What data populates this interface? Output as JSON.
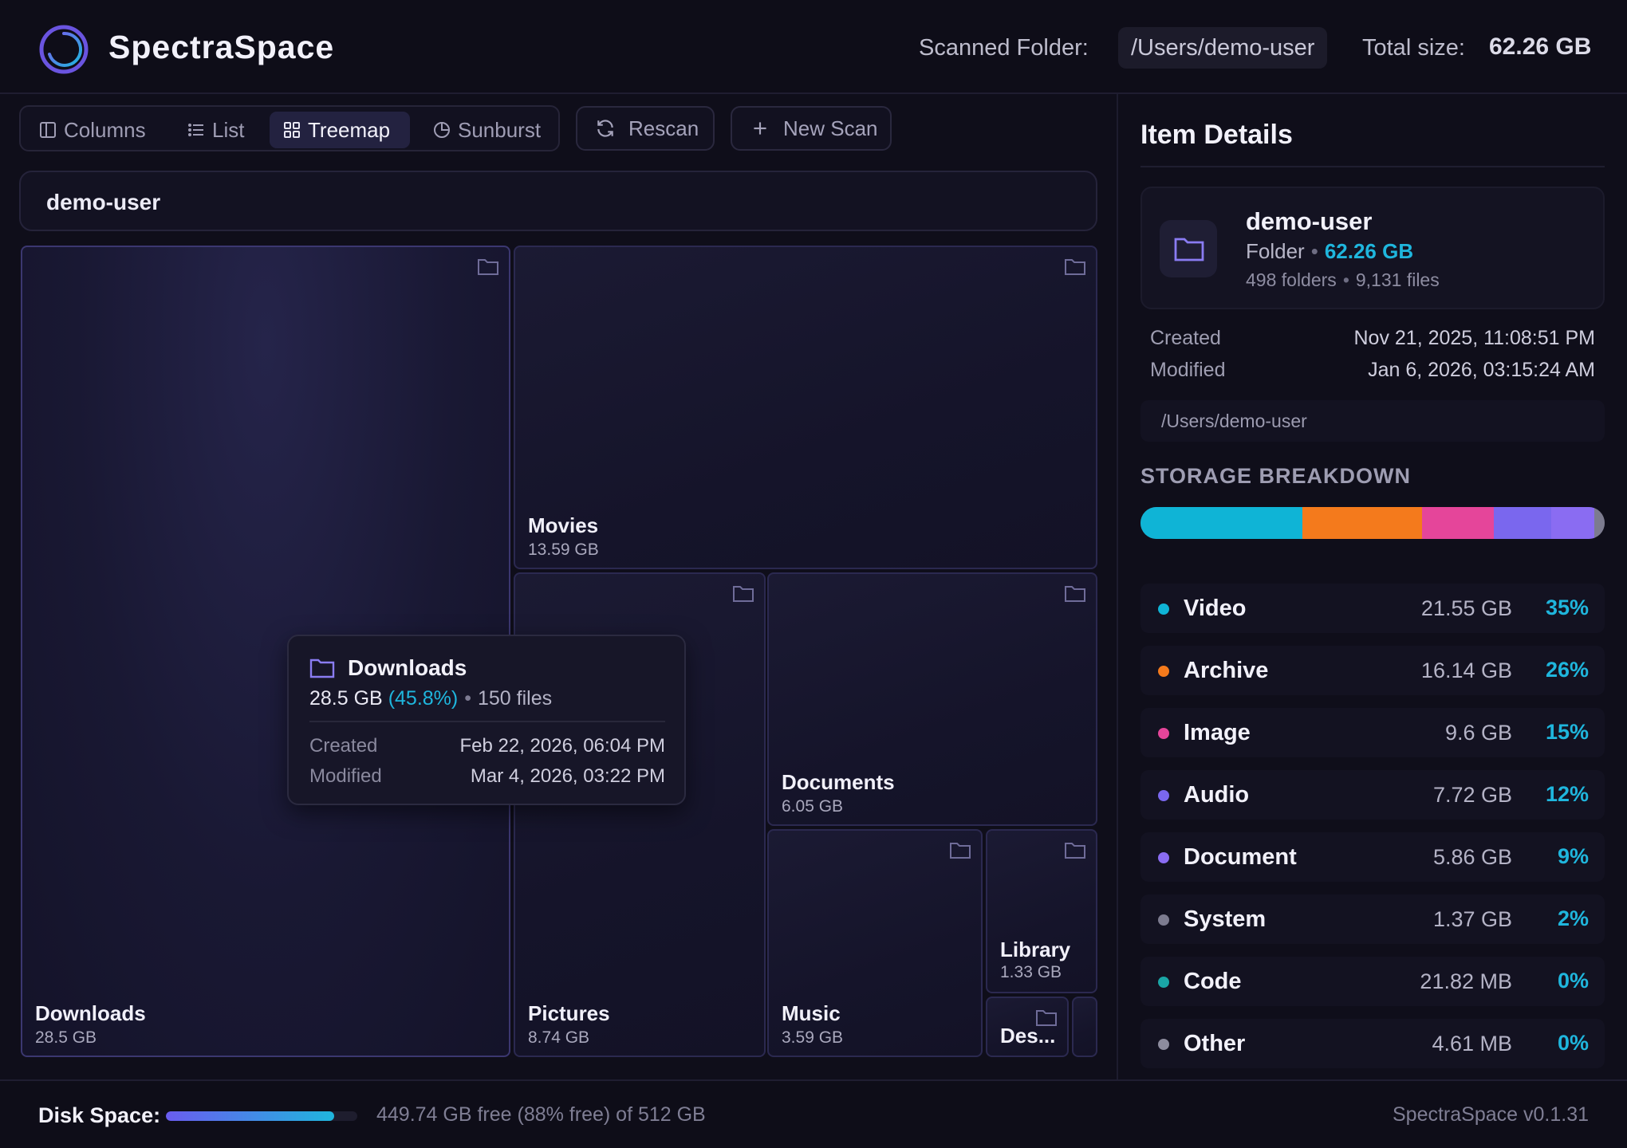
{
  "app": {
    "title": "SpectraSpace",
    "version": "SpectraSpace v0.1.31"
  },
  "header": {
    "scanned_label": "Scanned Folder:",
    "scanned_path": "/Users/demo-user",
    "total_label": "Total size:",
    "total_value": "62.26 GB"
  },
  "toolbar": {
    "views": [
      {
        "label": "Columns",
        "icon": "columns-icon"
      },
      {
        "label": "List",
        "icon": "list-icon"
      },
      {
        "label": "Treemap",
        "icon": "treemap-icon",
        "active": true
      },
      {
        "label": "Sunburst",
        "icon": "sunburst-icon"
      }
    ],
    "rescan_label": "Rescan",
    "new_scan_label": "New Scan"
  },
  "breadcrumb": "demo-user",
  "treemap": {
    "tiles": [
      {
        "name": "Downloads",
        "size": "28.5 GB"
      },
      {
        "name": "Movies",
        "size": "13.59 GB"
      },
      {
        "name": "Pictures",
        "size": "8.74 GB"
      },
      {
        "name": "Documents",
        "size": "6.05 GB"
      },
      {
        "name": "Music",
        "size": "3.59 GB"
      },
      {
        "name": "Library",
        "size": "1.33 GB"
      },
      {
        "name": "Des..."
      }
    ]
  },
  "tooltip": {
    "title": "Downloads",
    "size": "28.5 GB",
    "percent": "(45.8%)",
    "separator": "•",
    "files": "150 files",
    "created_label": "Created",
    "created_value": "Feb 22, 2026, 06:04 PM",
    "modified_label": "Modified",
    "modified_value": "Mar 4, 2026, 03:22 PM"
  },
  "details": {
    "title": "Item Details",
    "name": "demo-user",
    "type": "Folder",
    "separator": "•",
    "size": "62.26 GB",
    "folders": "498 folders",
    "files": "9,131 files",
    "created_label": "Created",
    "created_value": "Nov 21, 2025, 11:08:51 PM",
    "modified_label": "Modified",
    "modified_value": "Jan 6, 2026, 03:15:24 AM",
    "path": "/Users/demo-user"
  },
  "storage": {
    "title": "STORAGE BREAKDOWN",
    "categories": [
      {
        "name": "Video",
        "size": "21.55 GB",
        "pct": "35%",
        "fraction": 0.35,
        "color": "#0fb4d6"
      },
      {
        "name": "Archive",
        "size": "16.14 GB",
        "pct": "26%",
        "fraction": 0.26,
        "color": "#f47a1c"
      },
      {
        "name": "Image",
        "size": "9.6 GB",
        "pct": "15%",
        "fraction": 0.155,
        "color": "#e5459a"
      },
      {
        "name": "Audio",
        "size": "7.72 GB",
        "pct": "12%",
        "fraction": 0.124,
        "color": "#7a67ee"
      },
      {
        "name": "Document",
        "size": "5.86 GB",
        "pct": "9%",
        "fraction": 0.094,
        "color": "#8a6cf2"
      },
      {
        "name": "System",
        "size": "1.37 GB",
        "pct": "2%",
        "fraction": 0.022,
        "color": "#7c7b8f"
      },
      {
        "name": "Code",
        "size": "21.82 MB",
        "pct": "0%",
        "fraction": 0.0,
        "color": "#1aa6a6"
      },
      {
        "name": "Other",
        "size": "4.61 MB",
        "pct": "0%",
        "fraction": 0.0,
        "color": "#8d8c9e"
      }
    ]
  },
  "footer": {
    "disk_label": "Disk Space:",
    "disk_text": "449.74 GB free (88% free) of 512 GB",
    "disk_used_fraction": 0.88
  },
  "colors": {
    "accent": "#1fb6dd",
    "folder": "#8a7cf2",
    "background": "#0f0e1a"
  }
}
